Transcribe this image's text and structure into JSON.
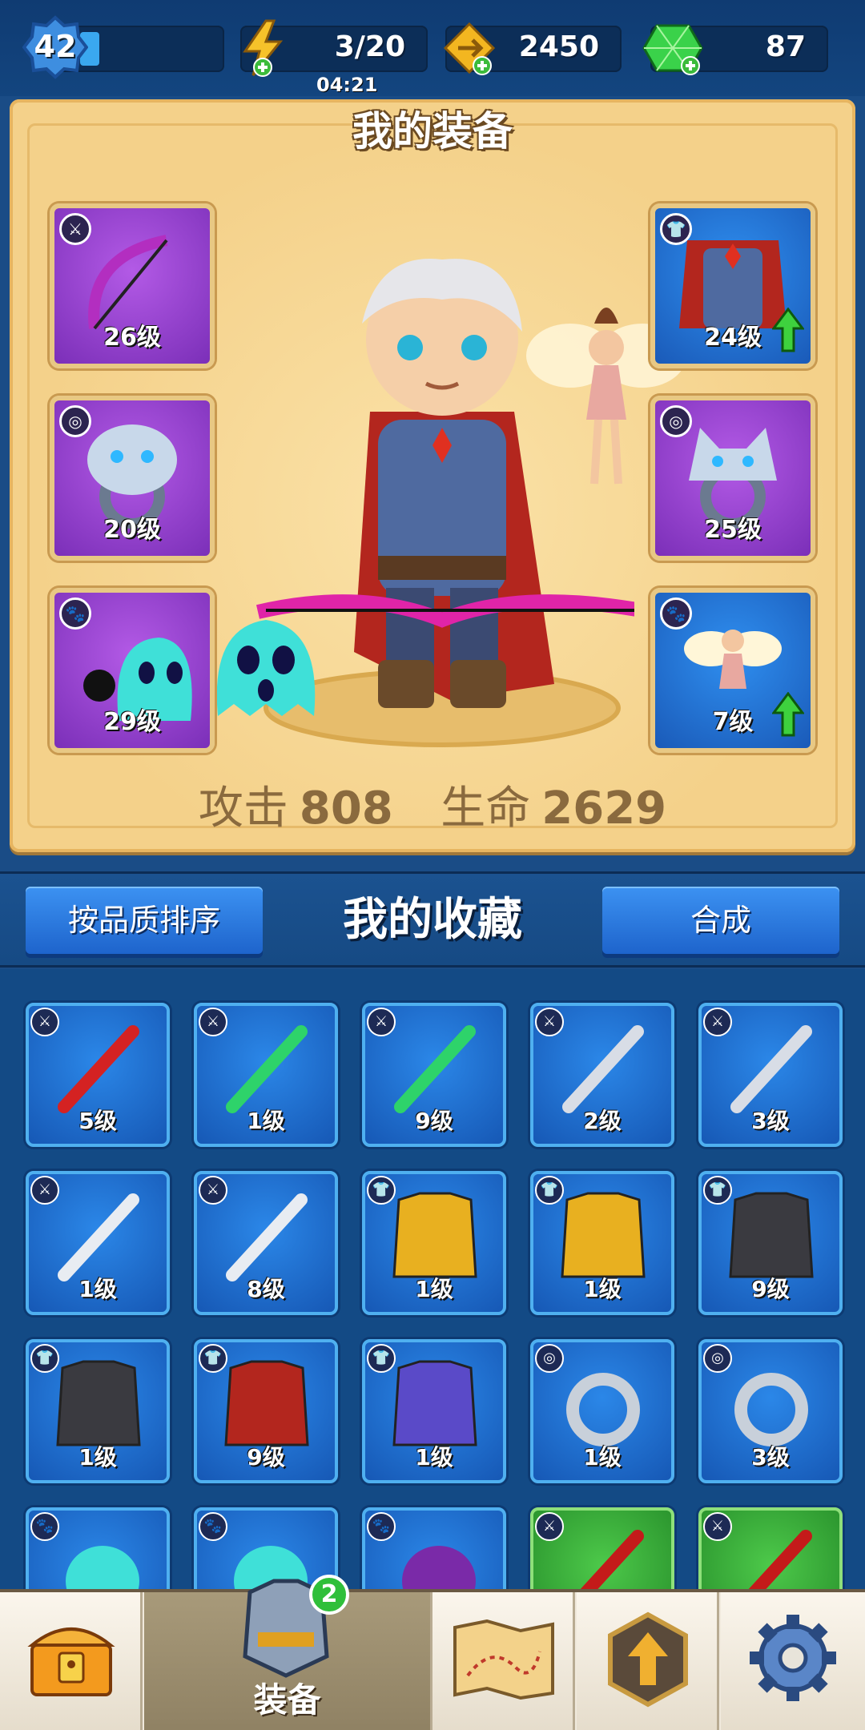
{
  "topbar": {
    "player_level": "42",
    "energy": "3/20",
    "energy_timer": "04:21",
    "gold": "2450",
    "gems": "87"
  },
  "equipment": {
    "title": "我的装备",
    "left_slots": [
      {
        "name": "weapon-bow",
        "level": "26级",
        "rarity": "purple",
        "type_icon": "weapon-icon"
      },
      {
        "name": "ring-bear",
        "level": "20级",
        "rarity": "purple",
        "type_icon": "ring-icon"
      },
      {
        "name": "pet-ghost",
        "level": "29级",
        "rarity": "purple",
        "type_icon": "paw-icon"
      }
    ],
    "right_slots": [
      {
        "name": "armor-cape",
        "level": "24级",
        "rarity": "blue",
        "type_icon": "armor-icon",
        "upgrade": true
      },
      {
        "name": "ring-wolf",
        "level": "25级",
        "rarity": "purple",
        "type_icon": "ring-icon",
        "upgrade": false
      },
      {
        "name": "pet-fairy",
        "level": "7级",
        "rarity": "blue",
        "type_icon": "paw-icon",
        "upgrade": true
      }
    ],
    "stats": {
      "attack_label": "攻击",
      "attack_value": "808",
      "hp_label": "生命",
      "hp_value": "2629"
    }
  },
  "collection": {
    "sort_button": "按品质排序",
    "title": "我的收藏",
    "merge_button": "合成",
    "items": [
      {
        "name": "red-bow",
        "level": "5级",
        "type": "weapon",
        "rarity": "blue"
      },
      {
        "name": "green-scythe",
        "level": "1级",
        "type": "weapon",
        "rarity": "blue"
      },
      {
        "name": "green-scythe",
        "level": "9级",
        "type": "weapon",
        "rarity": "blue"
      },
      {
        "name": "sword",
        "level": "2级",
        "type": "weapon",
        "rarity": "blue"
      },
      {
        "name": "sword",
        "level": "3级",
        "type": "weapon",
        "rarity": "blue"
      },
      {
        "name": "shuriken",
        "level": "1级",
        "type": "weapon",
        "rarity": "blue"
      },
      {
        "name": "shuriken",
        "level": "8级",
        "type": "weapon",
        "rarity": "blue"
      },
      {
        "name": "gold-armor",
        "level": "1级",
        "type": "armor",
        "rarity": "blue"
      },
      {
        "name": "gold-armor",
        "level": "1级",
        "type": "armor",
        "rarity": "blue"
      },
      {
        "name": "dark-vest",
        "level": "9级",
        "type": "armor",
        "rarity": "blue"
      },
      {
        "name": "dark-vest",
        "level": "1级",
        "type": "armor",
        "rarity": "blue"
      },
      {
        "name": "red-cape-armor",
        "level": "9级",
        "type": "armor",
        "rarity": "blue"
      },
      {
        "name": "purple-robe",
        "level": "1级",
        "type": "armor",
        "rarity": "blue"
      },
      {
        "name": "eagle-ring",
        "level": "1级",
        "type": "ring",
        "rarity": "blue"
      },
      {
        "name": "eagle-ring",
        "level": "3级",
        "type": "ring",
        "rarity": "blue"
      },
      {
        "name": "ghost-pet",
        "level": "",
        "type": "pet",
        "rarity": "blue"
      },
      {
        "name": "ghost-pet",
        "level": "",
        "type": "pet",
        "rarity": "blue"
      },
      {
        "name": "bat-pet",
        "level": "",
        "type": "pet",
        "rarity": "blue"
      },
      {
        "name": "red-scythe",
        "level": "",
        "type": "weapon",
        "rarity": "green"
      },
      {
        "name": "red-scythe",
        "level": "",
        "type": "weapon",
        "rarity": "green"
      }
    ]
  },
  "bottom_nav": {
    "equip_label": "装备",
    "equip_badge": "2",
    "tabs": [
      "chest-icon",
      "armor-icon",
      "map-icon",
      "upgrade-icon",
      "gear-icon"
    ]
  }
}
